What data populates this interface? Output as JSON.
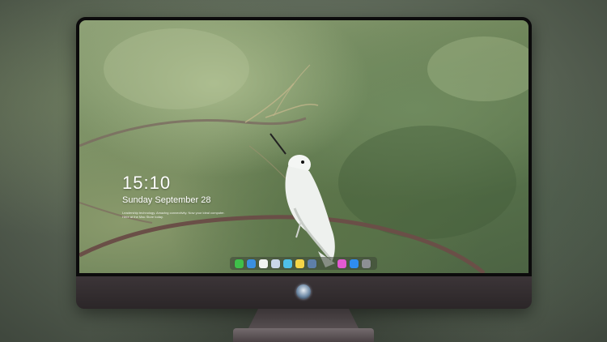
{
  "lock_screen": {
    "time": "15:10",
    "date": "Sunday September 28",
    "note": "Leadership technology. Amazing connectivity. Now your ideal computer. Here at the Mac Store today."
  },
  "dock": {
    "apps": [
      {
        "name": "messages-icon",
        "color": "#3fbf4a"
      },
      {
        "name": "finder-icon",
        "color": "#3a8fe0"
      },
      {
        "name": "clock-icon",
        "color": "#f2f2f2"
      },
      {
        "name": "preview-icon",
        "color": "#c9d6e8"
      },
      {
        "name": "videos-icon",
        "color": "#4fc0e8"
      },
      {
        "name": "notes-icon",
        "color": "#f5d547"
      },
      {
        "name": "photos-icon",
        "color": "#5e7fa8"
      },
      {
        "name": "music-icon",
        "color": "#e35ad1"
      },
      {
        "name": "app-store-icon",
        "color": "#2f8df0"
      },
      {
        "name": "camera-icon",
        "color": "#8d8f94"
      }
    ]
  },
  "colors": {
    "bezel": "#0c0b0c",
    "chin": "#3c3538",
    "text": "#ffffff"
  }
}
